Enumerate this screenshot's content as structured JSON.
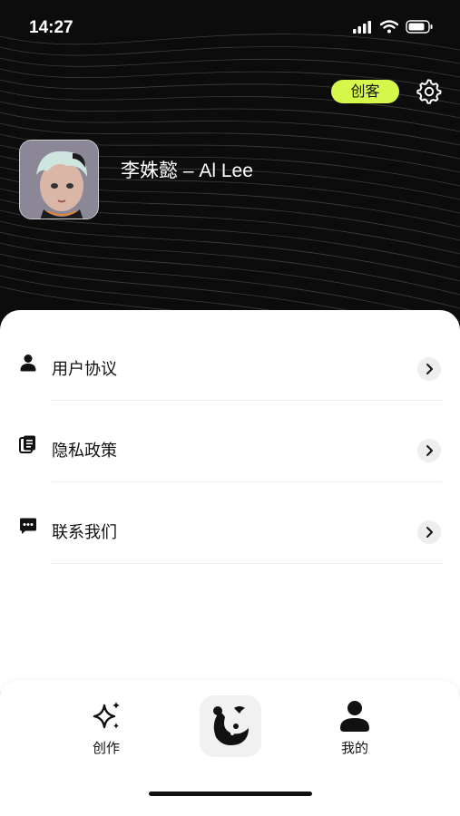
{
  "status_bar": {
    "time": "14:27"
  },
  "header": {
    "creator_badge": "创客",
    "username": "李姝懿 – Al Lee"
  },
  "menu": {
    "items": [
      {
        "label": "用户协议",
        "icon": "user-icon"
      },
      {
        "label": "隐私政策",
        "icon": "document-icon"
      },
      {
        "label": "联系我们",
        "icon": "message-icon"
      }
    ]
  },
  "tab_bar": {
    "tabs": [
      {
        "label": "创作",
        "icon": "sparkle-icon"
      },
      {
        "label": "",
        "icon": "app-logo-icon"
      },
      {
        "label": "我的",
        "icon": "person-icon"
      }
    ]
  },
  "colors": {
    "accent": "#d6f84a",
    "header_bg": "#0c0c0c",
    "text": "#111111"
  }
}
